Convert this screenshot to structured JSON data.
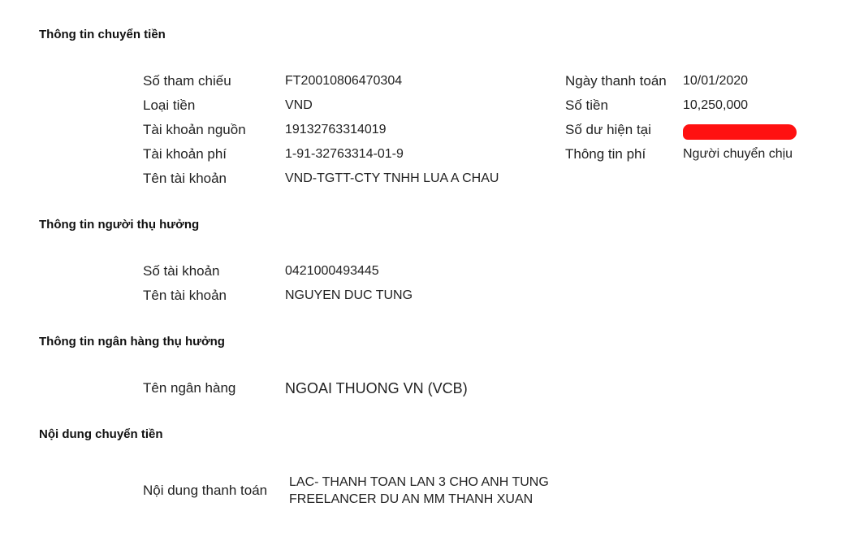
{
  "transfer_info": {
    "title": "Thông tin chuyển tiền",
    "reference_label": "Số tham chiếu",
    "reference_value": "FT20010806470304",
    "currency_label": "Loại tiền",
    "currency_value": "VND",
    "source_account_label": "Tài khoản nguồn",
    "source_account_value": "19132763314019",
    "fee_account_label": "Tài khoản phí",
    "fee_account_value": "1-91-32763314-01-9",
    "account_name_label": "Tên tài khoản",
    "account_name_value": "VND-TGTT-CTY TNHH LUA A CHAU",
    "payment_date_label": "Ngày thanh toán",
    "payment_date_value": "10/01/2020",
    "amount_label": "Số tiền",
    "amount_value": "10,250,000",
    "balance_label": "Số dư hiện tại",
    "balance_redaction_color": "#ff1111",
    "fee_info_label": "Thông tin phí",
    "fee_info_value": "Người chuyển chịu"
  },
  "beneficiary": {
    "title": "Thông tin người thụ hưởng",
    "account_number_label": "Số tài khoản",
    "account_number_value": "0421000493445",
    "account_name_label": "Tên tài khoản",
    "account_name_value": "NGUYEN DUC TUNG"
  },
  "beneficiary_bank": {
    "title": "Thông tin ngân hàng thụ hưởng",
    "bank_name_label": "Tên ngân hàng",
    "bank_name_value": "NGOAI THUONG VN (VCB)"
  },
  "memo": {
    "title": "Nội dung chuyển tiền",
    "content_label": "Nội dung thanh toán",
    "content_line1": "LAC- THANH TOAN LAN 3 CHO ANH TUNG",
    "content_line2": "FREELANCER DU AN MM THANH XUAN"
  }
}
